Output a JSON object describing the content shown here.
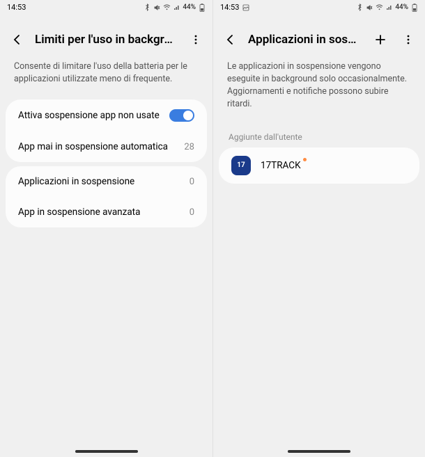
{
  "left": {
    "status": {
      "time": "14:53",
      "battery": "44%"
    },
    "header": {
      "title": "Limiti per l'uso in backgrou..."
    },
    "description": "Consente di limitare l'uso della batteria per le applicazioni utilizzate meno di frequente.",
    "group1": {
      "toggle_row": {
        "label": "Attiva sospensione app non usate"
      },
      "never_sleep": {
        "label": "App mai in sospensione automatica",
        "count": "28"
      }
    },
    "group2": {
      "sleeping": {
        "label": "Applicazioni in sospensione",
        "count": "0"
      },
      "deep_sleep": {
        "label": "App in sospensione avanzata",
        "count": "0"
      }
    }
  },
  "right": {
    "status": {
      "time": "14:53",
      "battery": "44%"
    },
    "header": {
      "title": "Applicazioni in sospens..."
    },
    "description": "Le applicazioni in sospensione vengono eseguite in background solo occasionalmente. Aggiornamenti e notifiche possono subire ritardi.",
    "section_label": "Aggiunte dall'utente",
    "apps": [
      {
        "icon_text": "17",
        "name": "17TRACK"
      }
    ]
  }
}
